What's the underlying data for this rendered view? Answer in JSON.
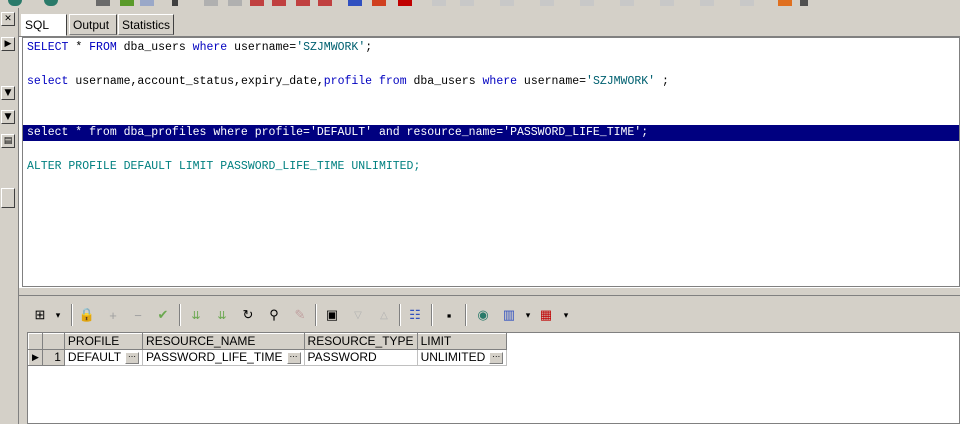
{
  "tabs": [
    {
      "label": "SQL",
      "active": true
    },
    {
      "label": "Output",
      "active": false
    },
    {
      "label": "Statistics",
      "active": false
    }
  ],
  "editor": {
    "lines": [
      [
        {
          "t": "SELECT",
          "c": "kw"
        },
        {
          "t": " * ",
          "c": "tx"
        },
        {
          "t": "FROM",
          "c": "kw"
        },
        {
          "t": " dba_users ",
          "c": "tx"
        },
        {
          "t": "where",
          "c": "kw"
        },
        {
          "t": " username=",
          "c": "tx"
        },
        {
          "t": "'SZJMWORK'",
          "c": "st"
        },
        {
          "t": ";",
          "c": "tx"
        }
      ],
      [
        {
          "t": "select",
          "c": "kw"
        },
        {
          "t": " username,account_status,expiry_date,",
          "c": "tx"
        },
        {
          "t": "profile",
          "c": "kw"
        },
        {
          "t": " ",
          "c": "tx"
        },
        {
          "t": "from",
          "c": "kw"
        },
        {
          "t": " dba_users ",
          "c": "tx"
        },
        {
          "t": "where",
          "c": "kw"
        },
        {
          "t": " username=",
          "c": "tx"
        },
        {
          "t": "'SZJMWORK'",
          "c": "st"
        },
        {
          "t": " ;",
          "c": "tx"
        }
      ],
      [
        {
          "t": "select * from dba_profiles where profile='DEFAULT' and resource_name='PASSWORD_LIFE_TIME';",
          "c": "hl"
        }
      ],
      [
        {
          "t": "ALTER PROFILE DEFAULT LIMIT PASSWORD_LIFE_TIME UNLIMITED;",
          "c": "tl"
        }
      ]
    ],
    "highlighted_line": 2
  },
  "grid_toolbar": {
    "icons": [
      "grid-layout-icon",
      "lock-icon",
      "add-record-icon",
      "delete-record-icon",
      "post-check-icon",
      "filter-down-icon",
      "filter-clear-icon",
      "refresh-icon",
      "find-binoculars-icon",
      "clear-icon",
      "query-icon",
      "sort-desc-icon",
      "sort-asc-icon",
      "tree-icon",
      "save-icon",
      "export-icon",
      "chart-icon",
      "table-icon"
    ]
  },
  "results": {
    "columns": [
      "PROFILE",
      "RESOURCE_NAME",
      "RESOURCE_TYPE",
      "LIMIT"
    ],
    "rows": [
      {
        "num": "1",
        "cells": [
          "DEFAULT",
          "PASSWORD_LIFE_TIME",
          "PASSWORD",
          "UNLIMITED"
        ]
      }
    ]
  },
  "colors": {
    "selection": "#000080",
    "keyword": "#0000c0",
    "literal": "#006070",
    "chrome": "#d4d0c8"
  }
}
